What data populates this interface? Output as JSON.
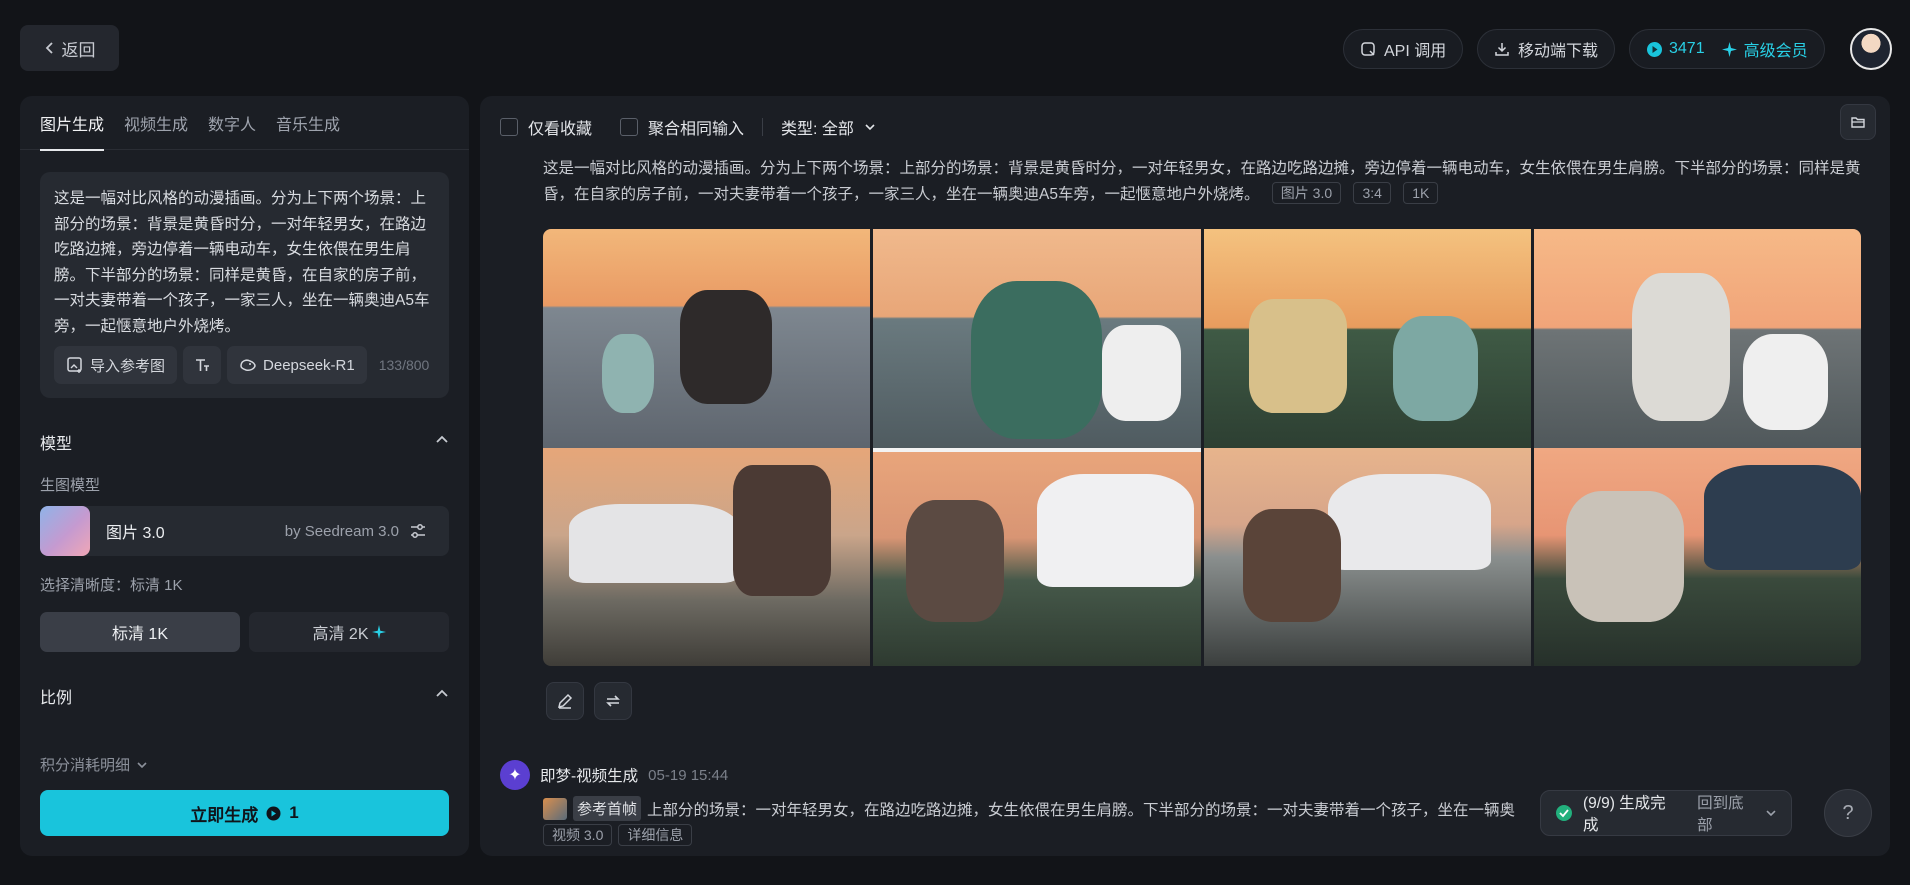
{
  "header": {
    "back_label": "返回",
    "api_label": "API 调用",
    "download_label": "移动端下载",
    "credits": "3471",
    "vip_label": "高级会员"
  },
  "left": {
    "tabs": [
      {
        "label": "图片生成",
        "active": true
      },
      {
        "label": "视频生成",
        "active": false
      },
      {
        "label": "数字人",
        "active": false
      },
      {
        "label": "音乐生成",
        "active": false
      }
    ],
    "prompt": "这是一幅对比风格的动漫插画。分为上下两个场景：上部分的场景：背景是黄昏时分，一对年轻男女，在路边吃路边摊，旁边停着一辆电动车，女生依偎在男生肩膀。下半部分的场景：同样是黄昏，在自家的房子前，一对夫妻带着一个孩子，一家三人，坐在一辆奥迪A5车旁，一起惬意地户外烧烤。",
    "import_ref_label": "导入参考图",
    "deepseek_label": "Deepseek-R1",
    "char_count": "133/800",
    "model_section": "模型",
    "model_sub": "生图模型",
    "model_name": "图片 3.0",
    "model_by": "by Seedream 3.0",
    "resolution_label": "选择清晰度：标清 1K",
    "res_1k": "标清 1K",
    "res_2k": "高清 2K",
    "ratio_section": "比例",
    "cost_detail": "积分消耗明细",
    "generate_label": "立即生成",
    "generate_cost": "1"
  },
  "main": {
    "filter_fav": "仅看收藏",
    "filter_group": "聚合相同输入",
    "filter_type": "类型: 全部",
    "gen_prompt": "这是一幅对比风格的动漫插画。分为上下两个场景：上部分的场景：背景是黄昏时分，一对年轻男女，在路边吃路边摊，旁边停着一辆电动车，女生依偎在男生肩膀。下半部分的场景：同样是黄昏，在自家的房子前，一对夫妻带着一个孩子，一家三人，坐在一辆奥迪A5车旁，一起惬意地户外烧烤。",
    "tags": [
      "图片 3.0",
      "3:4",
      "1K"
    ],
    "video": {
      "title": "即梦-视频生成",
      "time": "05-19  15:44",
      "ref_label": "参考首帧",
      "text": "上部分的场景：一对年轻男女，在路边吃路边摊，女生依偎在男生肩膀。下半部分的场景：一对夫妻带着一个孩子，坐在一辆奥",
      "tags": [
        "视频 3.0",
        "详细信息"
      ]
    }
  },
  "toast": {
    "status": "(9/9) 生成完成",
    "back_bottom": "回到底部"
  },
  "colors": {
    "accent": "#19c4dc",
    "background": "#121418",
    "panel": "#1b1e24"
  }
}
